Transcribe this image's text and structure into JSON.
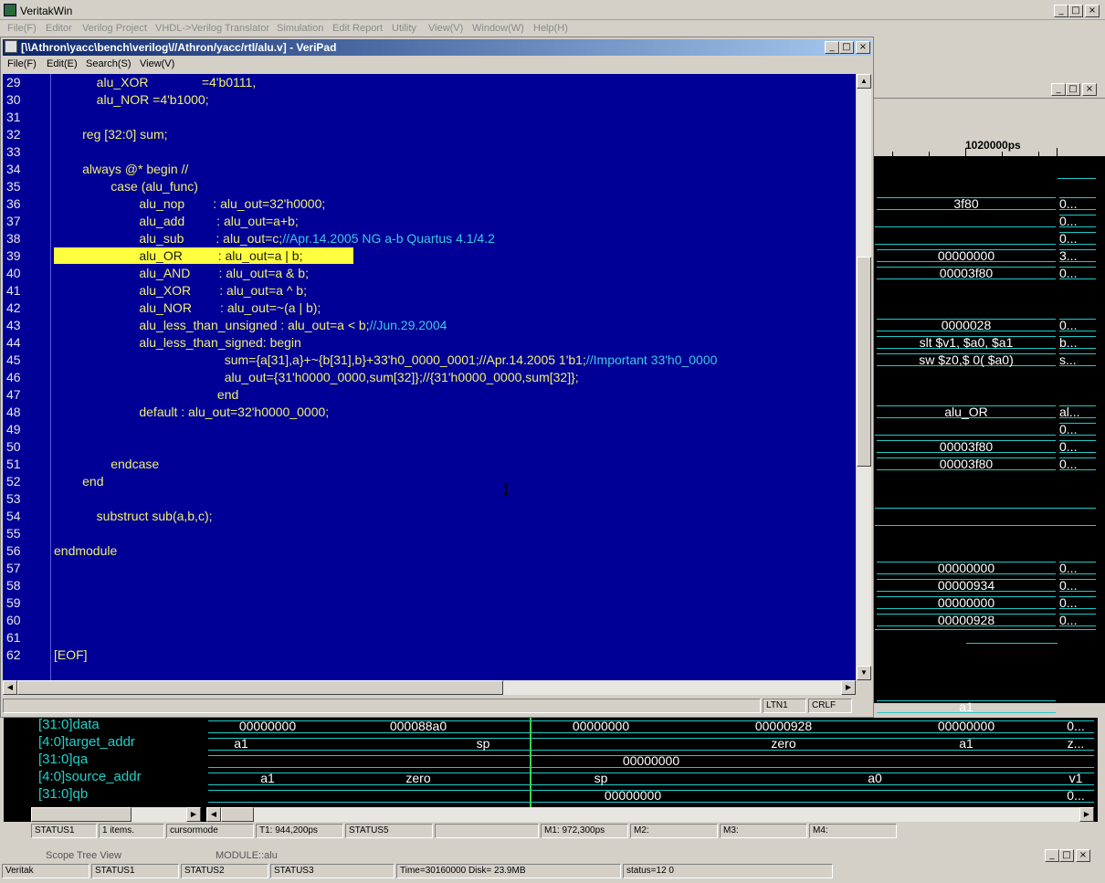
{
  "app": {
    "title": "VeritakWin",
    "menu": [
      "File(F)",
      "Editor",
      "Verilog Project",
      "VHDL->Verilog Translator",
      "Simulation",
      "Edit Report",
      "Utility",
      "View(V)",
      "Window(W)",
      "Help(H)"
    ],
    "status": [
      "Veritak",
      "STATUS1",
      "STATUS2",
      "STATUS3",
      "Time=30160000 Disk= 23.9MB",
      "status=12 0"
    ]
  },
  "veripad": {
    "title": "[\\\\Athron\\yacc\\bench\\verilog\\//Athron/yacc/rtl/alu.v] - VeriPad",
    "menu": [
      "File(F)",
      "Edit(E)",
      "Search(S)",
      "View(V)"
    ],
    "lines": [
      {
        "n": "29",
        "code": "            alu_XOR               =4'b0111,",
        "comment": ""
      },
      {
        "n": "30",
        "code": "            alu_NOR =4'b1000;",
        "comment": ""
      },
      {
        "n": "31",
        "code": "",
        "comment": ""
      },
      {
        "n": "32",
        "code": "        reg [32:0] sum;",
        "comment": ""
      },
      {
        "n": "33",
        "code": "",
        "comment": ""
      },
      {
        "n": "34",
        "code": "        always @* begin //",
        "comment": ""
      },
      {
        "n": "35",
        "code": "                case (alu_func)",
        "comment": ""
      },
      {
        "n": "36",
        "code": "                        alu_nop        : alu_out=32'h0000;",
        "comment": ""
      },
      {
        "n": "37",
        "code": "                        alu_add         : alu_out=a+b;",
        "comment": ""
      },
      {
        "n": "38",
        "code": "                        alu_sub         : alu_out=c;",
        "comment": "//Apr.14.2005 NG a-b Quartus 4.1/4.2"
      },
      {
        "n": "39",
        "code": "                        alu_OR          : alu_out=a | b;",
        "comment": ""
      },
      {
        "n": "40",
        "code": "                        alu_AND        : alu_out=a & b;",
        "comment": ""
      },
      {
        "n": "41",
        "code": "                        alu_XOR        : alu_out=a ^ b;",
        "comment": ""
      },
      {
        "n": "42",
        "code": "                        alu_NOR        : alu_out=~(a | b);",
        "comment": ""
      },
      {
        "n": "43",
        "code": "                        alu_less_than_unsigned : alu_out=a < b;",
        "comment": "//Jun.29.2004"
      },
      {
        "n": "44",
        "code": "                        alu_less_than_signed: begin",
        "comment": ""
      },
      {
        "n": "45",
        "code": "                                                sum={a[31],a}+~{b[31],b}+33'h0_0000_0001;//Apr.14.2005 1'b1;",
        "comment": "//Important 33'h0_0000"
      },
      {
        "n": "46",
        "code": "                                                alu_out={31'h0000_0000,sum[32]};//{31'h0000_0000,sum[32]};",
        "comment": ""
      },
      {
        "n": "47",
        "code": "                                              end",
        "comment": ""
      },
      {
        "n": "48",
        "code": "                        default : alu_out=32'h0000_0000;",
        "comment": ""
      },
      {
        "n": "49",
        "code": "",
        "comment": ""
      },
      {
        "n": "50",
        "code": "",
        "comment": ""
      },
      {
        "n": "51",
        "code": "                endcase",
        "comment": ""
      },
      {
        "n": "52",
        "code": "        end",
        "comment": ""
      },
      {
        "n": "53",
        "code": "",
        "comment": ""
      },
      {
        "n": "54",
        "code": "            substruct sub(a,b,c);",
        "comment": ""
      },
      {
        "n": "55",
        "code": "",
        "comment": ""
      },
      {
        "n": "56",
        "code": "endmodule",
        "comment": ""
      },
      {
        "n": "57",
        "code": "",
        "comment": ""
      },
      {
        "n": "58",
        "code": "",
        "comment": ""
      },
      {
        "n": "59",
        "code": "",
        "comment": ""
      },
      {
        "n": "60",
        "code": "",
        "comment": ""
      },
      {
        "n": "61",
        "code": "",
        "comment": ""
      },
      {
        "n": "62",
        "code": "[EOF]",
        "comment": ""
      }
    ],
    "highlight_line": "39",
    "status": [
      "LTN1",
      "CRLF"
    ]
  },
  "wave_top": {
    "ruler_label": "1020000ps",
    "values": [
      {
        "v": "3f80",
        "r": "0..."
      },
      {
        "v": "",
        "r": "0..."
      },
      {
        "v": "",
        "r": "0..."
      },
      {
        "v": "00000000",
        "r": "3..."
      },
      {
        "v": "00003f80",
        "r": "0..."
      },
      {
        "v": "0000028",
        "r": "0..."
      },
      {
        "v": "slt  $v1, $a0, $a1",
        "r": "b..."
      },
      {
        "v": "sw  $z0,$   0( $a0)",
        "r": "s..."
      },
      {
        "v": "alu_OR",
        "r": "al..."
      },
      {
        "v": "",
        "r": "0..."
      },
      {
        "v": "00003f80",
        "r": "0..."
      },
      {
        "v": "00003f80",
        "r": "0..."
      },
      {
        "v": "00000000",
        "r": "0..."
      },
      {
        "v": "00000934",
        "r": "0..."
      },
      {
        "v": "00000000",
        "r": "0..."
      },
      {
        "v": "00000928",
        "r": "0..."
      },
      {
        "v": "a1",
        "r": ""
      }
    ]
  },
  "wave_bottom": {
    "signals": [
      "[31:0]data",
      "[4:0]target_addr",
      "[31:0]qa",
      "[4:0]source_addr",
      "[31:0]qb"
    ],
    "data_row": [
      "00000000",
      "000088a0",
      "00000000",
      "00000928",
      "00000000",
      "0..."
    ],
    "target_row": [
      "a1",
      "sp",
      "zero",
      "a1",
      "z..."
    ],
    "qa_row": [
      "00000000"
    ],
    "source_row": [
      "a1",
      "zero",
      "sp",
      "a0",
      "v1"
    ],
    "qb_row": [
      "00000000",
      "0..."
    ],
    "status": [
      "STATUS1",
      "1 items.",
      "cursormode",
      "T1: 944,200ps",
      "STATUS5",
      "M1: 972,300ps",
      "M2:",
      "M3:",
      "M4:"
    ],
    "scope_title": "Scope Tree View",
    "scope_module": "MODULE::alu"
  }
}
